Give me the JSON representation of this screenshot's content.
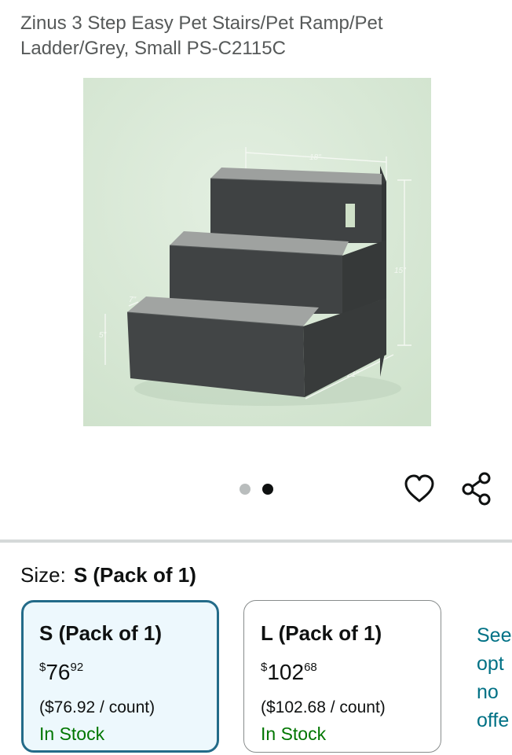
{
  "product": {
    "title": "Zinus 3 Step Easy Pet Stairs/Pet Ramp/Pet Ladder/Grey, Small PS-C2115C"
  },
  "gallery": {
    "dimensions": {
      "width": "18\"",
      "height": "15\"",
      "depth": "21\"",
      "step_depth": "7\"",
      "step_height": "5\""
    },
    "dots": 2,
    "active_dot": 1
  },
  "actions": {
    "favorite_icon": "heart-outline-icon",
    "share_icon": "share-icon"
  },
  "size": {
    "label": "Size:",
    "selected": "S (Pack of 1)",
    "options": [
      {
        "name": "S (Pack of 1)",
        "currency": "$",
        "whole": "76",
        "fraction": "92",
        "unit_price": "($76.92 / count)",
        "stock": "In Stock",
        "selected": true
      },
      {
        "name": "L (Pack of 1)",
        "currency": "$",
        "whole": "102",
        "fraction": "68",
        "unit_price": "($102.68 / count)",
        "stock": "In Stock",
        "selected": false
      }
    ],
    "see_more_lines": [
      "See",
      "opt",
      "no",
      "offe"
    ]
  },
  "colors": {
    "selected_border": "#236b89",
    "selected_bg": "#edf8fd",
    "stock": "#007600",
    "link": "#007185"
  }
}
